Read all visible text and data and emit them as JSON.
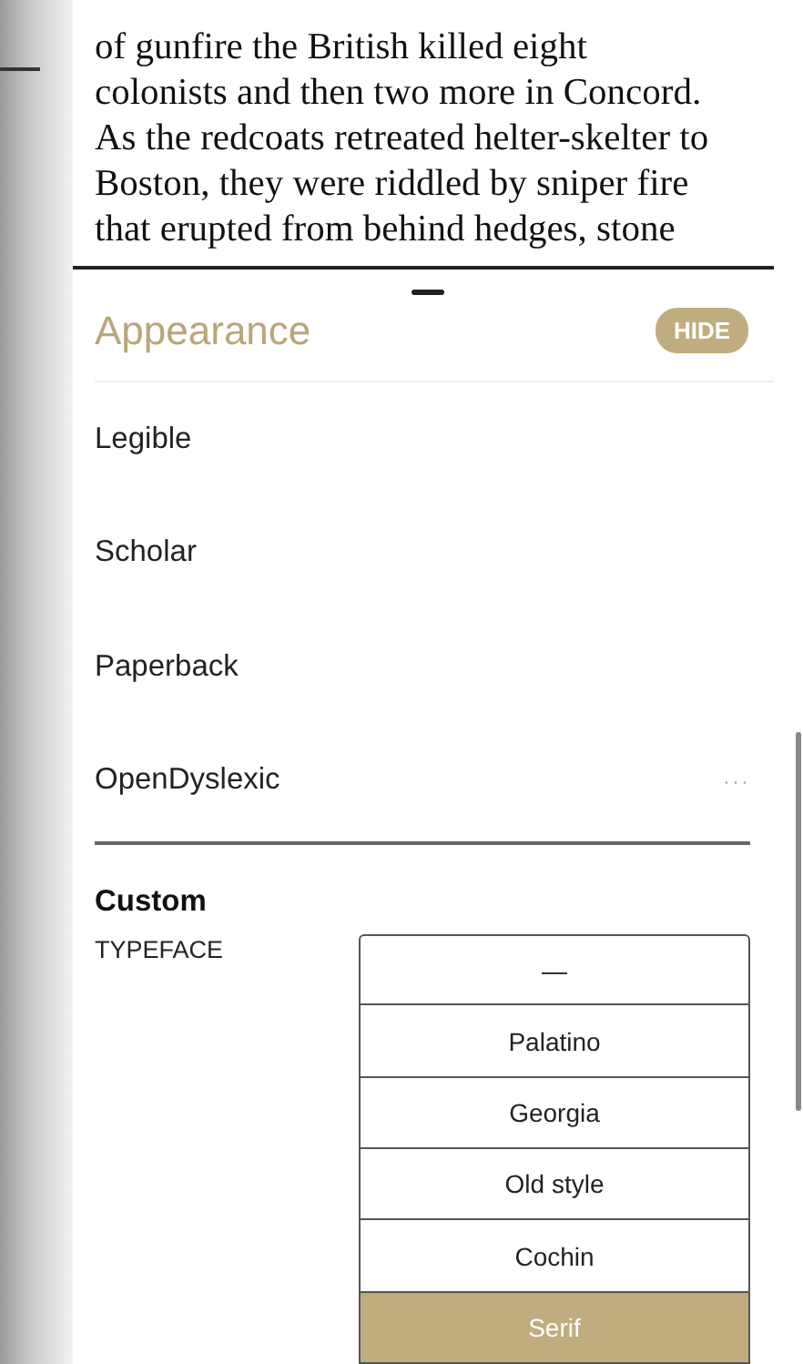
{
  "book_text": [
    "of gunfire the British killed eight",
    "colonists and then two more in Concord.",
    "As the redcoats retreated helter-skelter to",
    "Boston, they were riddled by sniper fire",
    "that erupted from behind hedges, stone"
  ],
  "sheet": {
    "title": "Appearance",
    "hide_button": "HIDE"
  },
  "themes": [
    {
      "label": "Legible"
    },
    {
      "label": "Scholar"
    },
    {
      "label": "Paperback"
    },
    {
      "label": "OpenDyslexic",
      "more": "···"
    }
  ],
  "custom": {
    "heading": "Custom",
    "typeface_label": "TYPEFACE",
    "typefaces": [
      {
        "label": "—",
        "selected": false
      },
      {
        "label": "Palatino",
        "selected": false
      },
      {
        "label": "Georgia",
        "selected": false
      },
      {
        "label": "Old style",
        "selected": false
      },
      {
        "label": "Cochin",
        "selected": false
      },
      {
        "label": "Serif",
        "selected": true
      }
    ]
  }
}
